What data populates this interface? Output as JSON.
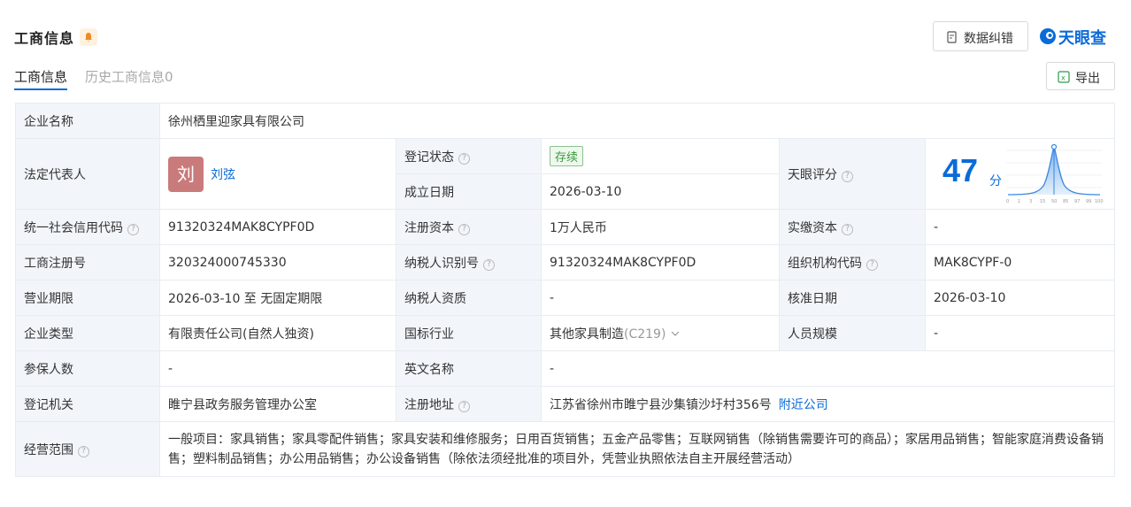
{
  "header": {
    "title": "工商信息",
    "correct_label": "数据纠错",
    "logo_text": "天眼查",
    "brand_color": "#0a6bd8"
  },
  "tabs": [
    {
      "label": "工商信息",
      "active": true
    },
    {
      "label": "历史工商信息0",
      "active": false
    }
  ],
  "export_label": "导出",
  "company": {
    "name_label": "企业名称",
    "name": "徐州栖里迎家具有限公司",
    "legal_rep_label": "法定代表人",
    "legal_rep_avatar": "刘",
    "legal_rep": "刘弦",
    "reg_status_label": "登记状态",
    "reg_status": "存续",
    "found_date_label": "成立日期",
    "found_date": "2026-03-10",
    "score_label": "天眼评分",
    "score": "47",
    "score_unit": "分",
    "score_ticks": [
      "0",
      "1",
      "3",
      "15",
      "50",
      "85",
      "97",
      "99",
      "100"
    ],
    "credit_code_label": "统一社会信用代码",
    "credit_code": "91320324MAK8CYPF0D",
    "reg_capital_label": "注册资本",
    "reg_capital": "1万人民币",
    "paid_capital_label": "实缴资本",
    "paid_capital": "-",
    "reg_no_label": "工商注册号",
    "reg_no": "320324000745330",
    "taxpayer_id_label": "纳税人识别号",
    "taxpayer_id": "91320324MAK8CYPF0D",
    "org_code_label": "组织机构代码",
    "org_code": "MAK8CYPF-0",
    "term_label": "营业期限",
    "term": "2026-03-10 至 无固定期限",
    "taxpayer_qual_label": "纳税人资质",
    "taxpayer_qual": "-",
    "approve_date_label": "核准日期",
    "approve_date": "2026-03-10",
    "type_label": "企业类型",
    "type": "有限责任公司(自然人独资)",
    "industry_label": "国标行业",
    "industry": "其他家具制造",
    "industry_code": "(C219)",
    "staff_label": "人员规模",
    "staff": "-",
    "insured_label": "参保人数",
    "insured": "-",
    "en_name_label": "英文名称",
    "en_name": "-",
    "authority_label": "登记机关",
    "authority": "睢宁县政务服务管理办公室",
    "address_label": "注册地址",
    "address": "江苏省徐州市睢宁县沙集镇沙圩村356号",
    "nearby_label": "附近公司",
    "scope_label": "经营范围",
    "scope": "一般项目：家具销售；家具零配件销售；家具安装和维修服务；日用百货销售；五金产品零售；互联网销售（除销售需要许可的商品）；家居用品销售；智能家庭消费设备销售；塑料制品销售；办公用品销售；办公设备销售（除依法须经批准的项目外，凭营业执照依法自主开展经营活动）"
  }
}
